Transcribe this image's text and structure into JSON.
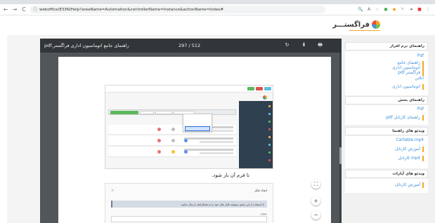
{
  "browser": {
    "url": "weboffice/E33N/Help?areaName=Automation&controllerName=Instance&actionName=Index#",
    "nav": {
      "back": "←",
      "forward": "→",
      "reload": "C",
      "info": "ⓘ"
    },
    "extensions": [
      {
        "name": "search-ext",
        "glyph": "🔍",
        "color": "#9aa0a6"
      },
      {
        "name": "translate-ext",
        "glyph": "A",
        "color": "#5f6368"
      },
      {
        "name": "star-ext",
        "glyph": "☆",
        "color": "#9aa0a6"
      },
      {
        "name": "circle-ext",
        "glyph": "●",
        "color": "#4caf50"
      },
      {
        "name": "orange-ext",
        "glyph": "◆",
        "color": "#ff9800"
      },
      {
        "name": "pen-ext",
        "glyph": "✎",
        "color": "#9aa0a6"
      },
      {
        "name": "share-ext",
        "glyph": "➜",
        "color": "#5f6368"
      },
      {
        "name": "red-ext",
        "glyph": "■",
        "color": "#e53935"
      },
      {
        "name": "menu-ext",
        "glyph": "⋮",
        "color": "#5f6368"
      }
    ]
  },
  "site": {
    "logo_text": "فراگستـــر",
    "accent": "#f5a623"
  },
  "pdf": {
    "title": "راهنمای جامع اتوماسیون اداری فراگستر.pdf",
    "page_indicator": "297 / 512",
    "tools": {
      "rotate": "↻",
      "download": "⬇",
      "print": "🖶"
    },
    "caption": "تا فرم آن باز شود.",
    "form": {
      "title": "ایجاد فایل",
      "close": "×",
      "info": "با استفاده از این بخش میتوانید فایل های خود را به همکارانتان ارسال نمایید.",
      "label": "عنوان"
    },
    "zoom": {
      "fit": "⛶",
      "in": "+",
      "out": "−"
    }
  },
  "sidebar": {
    "sections": [
      {
        "title": "راهنمای نرم افزار",
        "groups": [
          {
            "label": "Pdf",
            "items": [
              "راهنمای جامع اتوماسیون اداری فراگستر pdf"
            ]
          },
          {
            "label": "آنلاین",
            "items": [
              "اتوماسیون اداری"
            ]
          }
        ]
      },
      {
        "title": "راهنمای بخش",
        "groups": [
          {
            "label": "Pdf",
            "items": [
              "راهنمای کارتابل pdf."
            ]
          }
        ]
      },
      {
        "title": "ویدئو های راهنما",
        "groups": [
          {
            "label": "Cartable.mp4",
            "items": [
              "آموزش کارتابل",
              "mp4 کارتابل"
            ]
          }
        ]
      },
      {
        "title": "ویدئو های آپارات",
        "groups": [
          {
            "label": "",
            "items": [
              "آموزش کارتابل"
            ]
          }
        ]
      }
    ]
  }
}
